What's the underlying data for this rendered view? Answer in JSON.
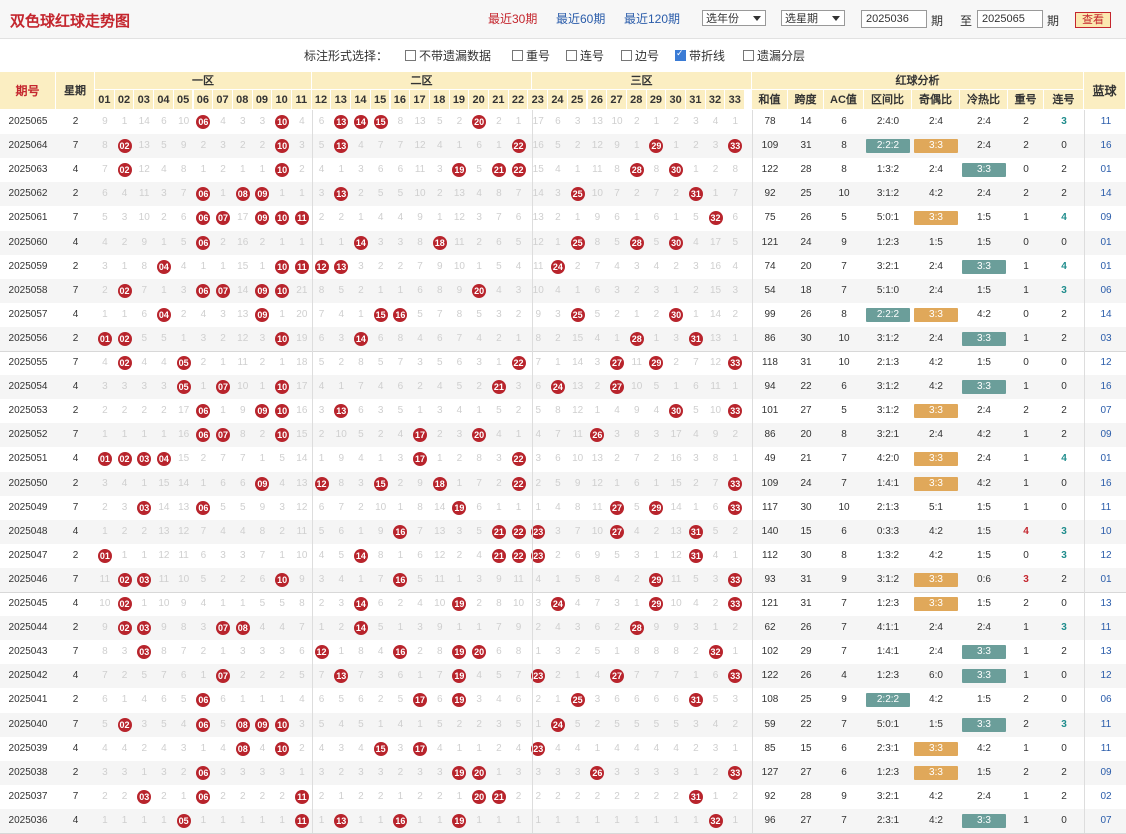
{
  "title": "双色球红球走势图",
  "ranges": [
    {
      "label": "最近30期",
      "active": true
    },
    {
      "label": "最近60期",
      "active": false
    },
    {
      "label": "最近120期",
      "active": false
    }
  ],
  "year_select": "选年份",
  "week_select": "选星期",
  "from_value": "2025036",
  "from_unit": "期",
  "to_label": "至",
  "to_value": "2025065",
  "to_unit": "期",
  "query_label": "查看",
  "options_label": "标注形式选择：",
  "options": [
    {
      "label": "不带遗漏数据",
      "checked": false
    },
    {
      "label": "重号",
      "checked": false
    },
    {
      "label": "连号",
      "checked": false
    },
    {
      "label": "边号",
      "checked": false
    },
    {
      "label": "带折线",
      "checked": true
    },
    {
      "label": "遗漏分层",
      "checked": false
    }
  ],
  "headers": {
    "issue": "期号",
    "week": "星期",
    "zone1": "一区",
    "zone2": "二区",
    "zone3": "三区",
    "analysis": "红球分析",
    "blue": "蓝球",
    "cols": [
      "和值",
      "跨度",
      "AC值",
      "区间比",
      "奇偶比",
      "冷热比",
      "重号",
      "连号"
    ]
  },
  "numbers": [
    "01",
    "02",
    "03",
    "04",
    "05",
    "06",
    "07",
    "08",
    "09",
    "10",
    "11",
    "12",
    "13",
    "14",
    "15",
    "16",
    "17",
    "18",
    "19",
    "20",
    "21",
    "22",
    "23",
    "24",
    "25",
    "26",
    "27",
    "28",
    "29",
    "30",
    "31",
    "32",
    "33"
  ],
  "rows": [
    {
      "issue": "2025065",
      "week": "2",
      "balls": [
        6,
        10,
        13,
        14,
        15,
        20
      ],
      "sum": "78",
      "span": "14",
      "ac": "6",
      "zone": "2:4:0",
      "oe": "2:4",
      "hc": "2:4",
      "rep": "2",
      "con": "3",
      "blue": "11"
    },
    {
      "issue": "2025064",
      "week": "7",
      "balls": [
        2,
        10,
        13,
        22,
        29,
        33
      ],
      "sum": "109",
      "span": "31",
      "ac": "8",
      "zone": "2:2:2",
      "oe": "3:3",
      "hc": "2:4",
      "rep": "2",
      "con": "0",
      "blue": "16"
    },
    {
      "issue": "2025063",
      "week": "4",
      "balls": [
        2,
        10,
        19,
        21,
        22,
        28,
        30
      ],
      "sum": "122",
      "span": "28",
      "ac": "8",
      "zone": "1:3:2",
      "oe": "2:4",
      "hc": "3:3",
      "rep": "0",
      "con": "2",
      "blue": "01"
    },
    {
      "issue": "2025062",
      "week": "2",
      "balls": [
        6,
        8,
        9,
        13,
        25,
        31
      ],
      "sum": "92",
      "span": "25",
      "ac": "10",
      "zone": "3:1:2",
      "oe": "4:2",
      "hc": "2:4",
      "rep": "2",
      "con": "2",
      "blue": "14"
    },
    {
      "issue": "2025061",
      "week": "7",
      "balls": [
        6,
        7,
        9,
        10,
        11,
        32
      ],
      "sum": "75",
      "span": "26",
      "ac": "5",
      "zone": "5:0:1",
      "oe": "3:3",
      "hc": "1:5",
      "rep": "1",
      "con": "4",
      "blue": "09"
    },
    {
      "issue": "2025060",
      "week": "4",
      "balls": [
        6,
        14,
        18,
        25,
        28,
        30
      ],
      "sum": "121",
      "span": "24",
      "ac": "9",
      "zone": "1:2:3",
      "oe": "1:5",
      "hc": "1:5",
      "rep": "0",
      "con": "0",
      "blue": "01"
    },
    {
      "issue": "2025059",
      "week": "2",
      "balls": [
        4,
        10,
        11,
        12,
        13,
        24
      ],
      "sum": "74",
      "span": "20",
      "ac": "7",
      "zone": "3:2:1",
      "oe": "2:4",
      "hc": "3:3",
      "rep": "1",
      "con": "4",
      "blue": "01"
    },
    {
      "issue": "2025058",
      "week": "7",
      "balls": [
        2,
        6,
        7,
        9,
        10,
        20
      ],
      "sum": "54",
      "span": "18",
      "ac": "7",
      "zone": "5:1:0",
      "oe": "2:4",
      "hc": "1:5",
      "rep": "1",
      "con": "3",
      "blue": "06"
    },
    {
      "issue": "2025057",
      "week": "4",
      "balls": [
        4,
        9,
        15,
        16,
        25,
        30
      ],
      "sum": "99",
      "span": "26",
      "ac": "8",
      "zone": "2:2:2",
      "oe": "3:3",
      "hc": "4:2",
      "rep": "0",
      "con": "2",
      "blue": "14"
    },
    {
      "issue": "2025056",
      "week": "2",
      "balls": [
        1,
        2,
        10,
        14,
        28,
        31
      ],
      "sum": "86",
      "span": "30",
      "ac": "10",
      "zone": "3:1:2",
      "oe": "2:4",
      "hc": "3:3",
      "rep": "1",
      "con": "2",
      "blue": "03"
    },
    {
      "issue": "2025055",
      "week": "7",
      "balls": [
        2,
        5,
        22,
        27,
        29,
        33
      ],
      "sum": "118",
      "span": "31",
      "ac": "10",
      "zone": "2:1:3",
      "oe": "4:2",
      "hc": "1:5",
      "rep": "0",
      "con": "0",
      "blue": "12"
    },
    {
      "issue": "2025054",
      "week": "4",
      "balls": [
        5,
        7,
        10,
        21,
        24,
        27
      ],
      "sum": "94",
      "span": "22",
      "ac": "6",
      "zone": "3:1:2",
      "oe": "4:2",
      "hc": "3:3",
      "rep": "1",
      "con": "0",
      "blue": "16"
    },
    {
      "issue": "2025053",
      "week": "2",
      "balls": [
        6,
        9,
        10,
        13,
        30,
        33
      ],
      "sum": "101",
      "span": "27",
      "ac": "5",
      "zone": "3:1:2",
      "oe": "3:3",
      "hc": "2:4",
      "rep": "2",
      "con": "2",
      "blue": "07"
    },
    {
      "issue": "2025052",
      "week": "7",
      "balls": [
        6,
        7,
        10,
        17,
        20,
        26
      ],
      "sum": "86",
      "span": "20",
      "ac": "8",
      "zone": "3:2:1",
      "oe": "2:4",
      "hc": "4:2",
      "rep": "1",
      "con": "2",
      "blue": "09"
    },
    {
      "issue": "2025051",
      "week": "4",
      "balls": [
        1,
        2,
        3,
        4,
        17,
        22
      ],
      "sum": "49",
      "span": "21",
      "ac": "7",
      "zone": "4:2:0",
      "oe": "3:3",
      "hc": "2:4",
      "rep": "1",
      "con": "4",
      "blue": "01"
    },
    {
      "issue": "2025050",
      "week": "2",
      "balls": [
        9,
        12,
        15,
        18,
        22,
        33
      ],
      "sum": "109",
      "span": "24",
      "ac": "7",
      "zone": "1:4:1",
      "oe": "3:3",
      "hc": "4:2",
      "rep": "1",
      "con": "0",
      "blue": "16"
    },
    {
      "issue": "2025049",
      "week": "7",
      "balls": [
        3,
        6,
        19,
        27,
        29,
        33
      ],
      "sum": "117",
      "span": "30",
      "ac": "10",
      "zone": "2:1:3",
      "oe": "5:1",
      "hc": "1:5",
      "rep": "1",
      "con": "0",
      "blue": "11"
    },
    {
      "issue": "2025048",
      "week": "4",
      "balls": [
        16,
        21,
        22,
        23,
        27,
        31
      ],
      "sum": "140",
      "span": "15",
      "ac": "6",
      "zone": "0:3:3",
      "oe": "4:2",
      "hc": "1:5",
      "rep": "4",
      "con": "3",
      "blue": "10"
    },
    {
      "issue": "2025047",
      "week": "2",
      "balls": [
        1,
        14,
        21,
        22,
        23,
        31
      ],
      "sum": "112",
      "span": "30",
      "ac": "8",
      "zone": "1:3:2",
      "oe": "4:2",
      "hc": "1:5",
      "rep": "0",
      "con": "3",
      "blue": "12"
    },
    {
      "issue": "2025046",
      "week": "7",
      "balls": [
        2,
        3,
        10,
        16,
        29,
        33
      ],
      "sum": "93",
      "span": "31",
      "ac": "9",
      "zone": "3:1:2",
      "oe": "3:3",
      "hc": "0:6",
      "rep": "3",
      "con": "2",
      "blue": "01"
    },
    {
      "issue": "2025045",
      "week": "4",
      "balls": [
        2,
        14,
        19,
        24,
        29,
        33
      ],
      "sum": "121",
      "span": "31",
      "ac": "7",
      "zone": "1:2:3",
      "oe": "3:3",
      "hc": "1:5",
      "rep": "2",
      "con": "0",
      "blue": "13"
    },
    {
      "issue": "2025044",
      "week": "2",
      "balls": [
        2,
        3,
        7,
        8,
        14,
        28
      ],
      "sum": "62",
      "span": "26",
      "ac": "7",
      "zone": "4:1:1",
      "oe": "2:4",
      "hc": "2:4",
      "rep": "1",
      "con": "3",
      "blue": "11"
    },
    {
      "issue": "2025043",
      "week": "7",
      "balls": [
        3,
        12,
        16,
        19,
        20,
        32
      ],
      "sum": "102",
      "span": "29",
      "ac": "7",
      "zone": "1:4:1",
      "oe": "2:4",
      "hc": "3:3",
      "rep": "1",
      "con": "2",
      "blue": "13"
    },
    {
      "issue": "2025042",
      "week": "4",
      "balls": [
        7,
        13,
        19,
        23,
        27,
        33
      ],
      "sum": "122",
      "span": "26",
      "ac": "4",
      "zone": "1:2:3",
      "oe": "6:0",
      "hc": "3:3",
      "rep": "1",
      "con": "0",
      "blue": "12"
    },
    {
      "issue": "2025041",
      "week": "2",
      "balls": [
        6,
        17,
        19,
        25,
        31
      ],
      "sum": "108",
      "span": "25",
      "ac": "9",
      "zone": "2:2:2",
      "oe": "4:2",
      "hc": "1:5",
      "rep": "2",
      "con": "0",
      "blue": "06"
    },
    {
      "issue": "2025040",
      "week": "7",
      "balls": [
        2,
        6,
        8,
        9,
        10,
        24
      ],
      "sum": "59",
      "span": "22",
      "ac": "7",
      "zone": "5:0:1",
      "oe": "1:5",
      "hc": "3:3",
      "rep": "2",
      "con": "3",
      "blue": "11"
    },
    {
      "issue": "2025039",
      "week": "4",
      "balls": [
        8,
        10,
        15,
        17,
        23
      ],
      "sum": "85",
      "span": "15",
      "ac": "6",
      "zone": "2:3:1",
      "oe": "3:3",
      "hc": "4:2",
      "rep": "1",
      "con": "0",
      "blue": "11"
    },
    {
      "issue": "2025038",
      "week": "2",
      "balls": [
        6,
        19,
        20,
        26,
        33
      ],
      "sum": "127",
      "span": "27",
      "ac": "6",
      "zone": "1:2:3",
      "oe": "3:3",
      "hc": "1:5",
      "rep": "2",
      "con": "2",
      "blue": "09"
    },
    {
      "issue": "2025037",
      "week": "7",
      "balls": [
        3,
        6,
        11,
        20,
        21,
        31
      ],
      "sum": "92",
      "span": "28",
      "ac": "9",
      "zone": "3:2:1",
      "oe": "4:2",
      "hc": "2:4",
      "rep": "1",
      "con": "2",
      "blue": "02"
    },
    {
      "issue": "2025036",
      "week": "4",
      "balls": [
        5,
        11,
        13,
        16,
        19,
        32
      ],
      "sum": "96",
      "span": "27",
      "ac": "7",
      "zone": "2:3:1",
      "oe": "4:2",
      "hc": "3:3",
      "rep": "1",
      "con": "0",
      "blue": "07"
    }
  ]
}
